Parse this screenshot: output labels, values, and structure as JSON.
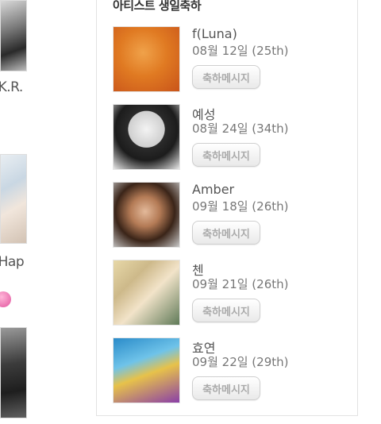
{
  "left": {
    "label_a": "-K.R.",
    "label_b": "-Hap"
  },
  "panel": {
    "title": "아티스트 생일축하",
    "button_label": "축하메시지",
    "items": [
      {
        "name": "f(Luna)",
        "date": "08월 12일 (25th)"
      },
      {
        "name": "예성",
        "date": "08월 24일 (34th)"
      },
      {
        "name": "Amber",
        "date": "09월 18일 (26th)"
      },
      {
        "name": "첸",
        "date": "09월 21일 (26th)"
      },
      {
        "name": "효연",
        "date": "09월 22일 (29th)"
      }
    ]
  }
}
